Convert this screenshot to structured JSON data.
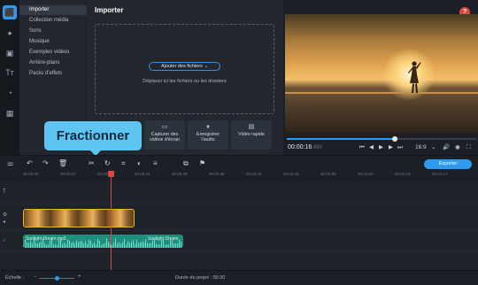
{
  "rail": {
    "items": [
      {
        "icon": "import-icon",
        "glyph": "⬛",
        "active": true
      },
      {
        "icon": "magic-wand-icon",
        "glyph": "✦",
        "active": false
      },
      {
        "icon": "filters-icon",
        "glyph": "▣",
        "active": false
      },
      {
        "icon": "titles-icon",
        "glyph": "Tт",
        "active": false
      },
      {
        "icon": "transitions-icon",
        "glyph": "◔",
        "active": false
      },
      {
        "icon": "more-tools-icon",
        "glyph": "▦",
        "active": false
      }
    ]
  },
  "categories": [
    {
      "label": "Importer",
      "active": true
    },
    {
      "label": "Collection média",
      "active": false
    },
    {
      "label": "Sons",
      "active": false
    },
    {
      "label": "Musique",
      "active": false
    },
    {
      "label": "Exemples vidéos",
      "active": false
    },
    {
      "label": "Arrière-plans",
      "active": false
    },
    {
      "label": "Packs d'effets",
      "active": false
    }
  ],
  "import": {
    "title": "Importer",
    "add_files": "Ajouter des fichiers",
    "drop_hint": "Déplacer ici les fichiers ou les dossiers",
    "tiles": [
      {
        "icon": "screen-capture-icon",
        "glyph": "▭",
        "label": "Capturer des vidéos d'écran"
      },
      {
        "icon": "microphone-icon",
        "glyph": "♦",
        "label": "Enregistrer l'audio"
      },
      {
        "icon": "quick-video-icon",
        "glyph": "▤",
        "label": "Vidéo rapide"
      }
    ]
  },
  "tooltip": {
    "text": "Fractionner"
  },
  "preview": {
    "help": "?",
    "timecode": "00:00:16",
    "timecode_ms": ".490",
    "progress": 0.57,
    "aspect": "16:9",
    "controls": {
      "prev": "⏮",
      "back": "◀",
      "play": "▶",
      "forward": "▶",
      "next": "⏭",
      "volume": "🔊",
      "snapshot": "◉",
      "fullscreen": "⛶"
    }
  },
  "toolbar": {
    "undo": "↶",
    "redo": "↷",
    "delete": "🗑",
    "split": "✂",
    "rotate": "↻",
    "crop": "⌗",
    "color": "◐",
    "align": "≡",
    "insert": "⧉",
    "flag": "⚑",
    "export": "Exporter"
  },
  "ruler": {
    "labels": [
      "00:00:00",
      "00:00:07",
      "00:00:14",
      "00:00:21",
      "00:00:28",
      "00:00:35",
      "00:00:42",
      "00:00:49",
      "00:00:56",
      "00:01:03",
      "00:01:10",
      "00:01:17"
    ]
  },
  "audio": {
    "label1": "Sunlight Dream.mp3",
    "label2": "Sunlight Dream"
  },
  "bottom": {
    "scale_label": "Échelle :",
    "minus": "−",
    "plus": "+",
    "zoom": 0.45,
    "duration_label": "Durée du projet :",
    "duration_value": "00:30"
  },
  "colors": {
    "accent": "#2f9bf0",
    "tooltip": "#5ec4f2",
    "playhead": "#e2453a",
    "clip_border": "#f0b22a",
    "audio": "#1d8f7c"
  }
}
